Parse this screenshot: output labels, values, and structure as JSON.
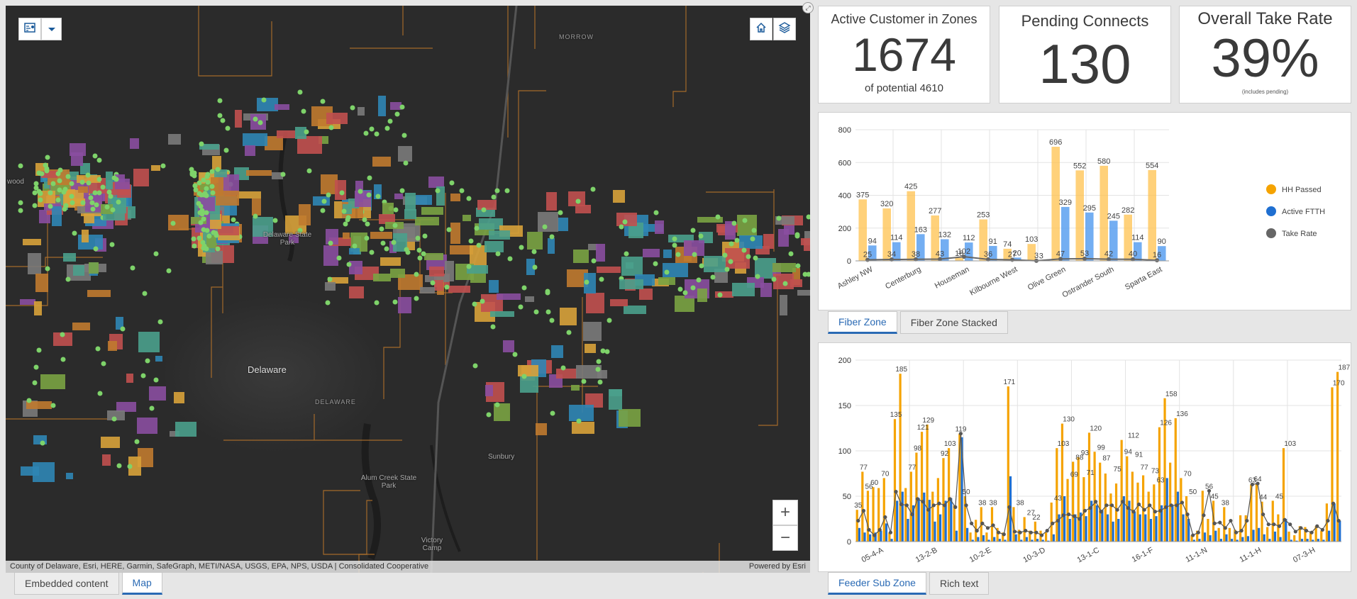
{
  "map": {
    "places": [
      {
        "text": "Delaware",
        "cls": "big"
      },
      {
        "text": "Delaware State Park",
        "cls": "small"
      },
      {
        "text": "MORROW",
        "cls": "tiny"
      },
      {
        "text": "DELAWARE",
        "cls": "tiny"
      },
      {
        "text": "Sunbury",
        "cls": "small"
      },
      {
        "text": "Alum Creek State Park",
        "cls": "small"
      },
      {
        "text": "Victory Camp",
        "cls": "small"
      },
      {
        "text": "wood",
        "cls": "small"
      }
    ],
    "attribution": "County of Delaware, Esri, HERE, Garmin, SafeGraph, METI/NASA, USGS, EPA, NPS, USDA | Consolidated Cooperative",
    "powered_by": "Powered by Esri",
    "zoom_in": "+",
    "zoom_out": "−",
    "icons": [
      "legend-icon",
      "chevron-down-icon",
      "home-icon",
      "layers-icon",
      "expand-icon"
    ]
  },
  "left_tabs": [
    {
      "label": "Embedded content",
      "active": false
    },
    {
      "label": "Map",
      "active": true
    }
  ],
  "kpis": [
    {
      "title": "Active Customer in Zones",
      "value": "1674",
      "subtitle": "of potential 4610"
    },
    {
      "title": "Pending Connects",
      "value": "130",
      "subtitle": ""
    },
    {
      "title": "Overall Take Rate",
      "value": "39%",
      "subtitle": "(includes pending)"
    }
  ],
  "chart_tabs_top": [
    {
      "label": "Fiber Zone",
      "active": true
    },
    {
      "label": "Fiber Zone Stacked",
      "active": false
    }
  ],
  "chart_tabs_bottom": [
    {
      "label": "Feeder Sub Zone",
      "active": true
    },
    {
      "label": "Rich text",
      "active": false
    }
  ],
  "colors": {
    "hh_passed": "#ffc24d",
    "hh_passed_bottom": "#f5a300",
    "active_ftth": "#5aa0f0",
    "active_ftth_bottom": "#1f6fd1",
    "take_rate": "#666666"
  },
  "chart_data": [
    {
      "type": "bar",
      "name": "fiber-zone",
      "categories": [
        "Ashley NW",
        "",
        "Centerburg",
        "",
        "Houseman",
        "",
        "Kilbourne West",
        "",
        "Olive Green",
        "",
        "Ostrander South",
        "",
        "Sparta East"
      ],
      "x_tick_labels": [
        "Ashley NW",
        "Centerburg",
        "Houseman",
        "Kilbourne West",
        "Olive Green",
        "Ostrander South",
        "Sparta East"
      ],
      "series": [
        {
          "name": "HH Passed",
          "values": [
            375,
            320,
            425,
            277,
            18,
            253,
            74,
            103,
            696,
            552,
            580,
            282,
            554
          ]
        },
        {
          "name": "Active FTTH",
          "values": [
            94,
            114,
            163,
            132,
            112,
            91,
            20,
            3,
            329,
            295,
            245,
            114,
            90
          ]
        },
        {
          "name": "Take Rate",
          "values": [
            25,
            34,
            38,
            43,
            102,
            36,
            27,
            3,
            47,
            53,
            42,
            40,
            16
          ]
        }
      ],
      "ylim": [
        0,
        800
      ],
      "yticks": [
        "0",
        "200",
        "400",
        "600",
        "800"
      ],
      "legend": "right",
      "grid": true
    },
    {
      "type": "bar",
      "name": "feeder-sub-zone",
      "x_tick_labels": [
        "05-4-A",
        "13-2-B",
        "10-2-E",
        "10-3-D",
        "13-1-C",
        "16-1-F",
        "11-1-N",
        "11-1-H",
        "07-3-H"
      ],
      "series": [
        {
          "name": "HH Passed",
          "values": [
            35,
            77,
            56,
            60,
            59,
            70,
            10,
            135,
            185,
            59,
            77,
            98,
            121,
            129,
            55,
            70,
            92,
            103,
            40,
            119,
            50,
            10,
            24,
            38,
            10,
            38,
            15,
            10,
            171,
            38,
            13,
            27,
            12,
            22,
            12,
            10,
            43,
            103,
            130,
            69,
            88,
            93,
            71,
            120,
            99,
            87,
            75,
            53,
            64,
            112,
            94,
            77,
            65,
            73,
            55,
            63,
            126,
            158,
            87,
            136,
            70,
            50,
            7,
            12,
            56,
            25,
            45,
            15,
            38,
            15,
            13,
            29,
            29,
            63,
            64,
            44,
            16,
            45,
            30,
            103,
            11,
            7,
            17,
            16,
            10,
            17,
            12,
            42,
            170,
            187
          ],
          "labeled": [
            [
              0,
              35
            ],
            [
              1,
              77
            ],
            [
              2,
              56
            ],
            [
              3,
              60
            ],
            [
              5,
              70
            ],
            [
              7,
              135
            ],
            [
              8,
              185
            ],
            [
              10,
              77
            ],
            [
              11,
              98
            ],
            [
              12,
              121
            ],
            [
              13,
              129
            ],
            [
              16,
              92
            ],
            [
              17,
              103
            ],
            [
              19,
              119
            ],
            [
              20,
              50
            ],
            [
              23,
              38
            ],
            [
              25,
              38
            ],
            [
              28,
              171
            ],
            [
              30,
              38
            ],
            [
              32,
              27
            ],
            [
              33,
              22
            ],
            [
              37,
              43
            ],
            [
              38,
              103
            ],
            [
              39,
              130
            ],
            [
              40,
              69
            ],
            [
              41,
              88
            ],
            [
              42,
              93
            ],
            [
              43,
              71
            ],
            [
              44,
              120
            ],
            [
              45,
              99
            ],
            [
              46,
              87
            ],
            [
              48,
              75
            ],
            [
              50,
              94
            ],
            [
              51,
              112
            ],
            [
              52,
              91
            ],
            [
              53,
              77
            ],
            [
              55,
              73
            ],
            [
              56,
              63
            ],
            [
              57,
              126
            ],
            [
              58,
              158
            ],
            [
              60,
              136
            ],
            [
              61,
              70
            ],
            [
              62,
              50
            ],
            [
              65,
              56
            ],
            [
              66,
              45
            ],
            [
              68,
              38
            ],
            [
              73,
              63
            ],
            [
              74,
              64
            ],
            [
              75,
              44
            ],
            [
              78,
              45
            ],
            [
              80,
              103
            ],
            [
              89,
              170
            ],
            [
              90,
              187
            ]
          ]
        },
        {
          "name": "Active FTTH",
          "values": [
            15,
            10,
            8,
            10,
            12,
            20,
            3,
            45,
            55,
            25,
            40,
            48,
            54,
            46,
            22,
            30,
            45,
            48,
            12,
            115,
            15,
            2,
            5,
            7,
            2,
            5,
            3,
            2,
            72,
            8,
            2,
            5,
            2,
            3,
            2,
            1,
            8,
            30,
            50,
            25,
            30,
            32,
            28,
            45,
            40,
            35,
            30,
            22,
            25,
            50,
            45,
            33,
            30,
            30,
            25,
            28,
            40,
            70,
            40,
            55,
            30,
            25,
            2,
            3,
            10,
            7,
            12,
            3,
            8,
            3,
            2,
            5,
            6,
            13,
            15,
            8,
            3,
            11,
            5,
            25,
            2,
            1,
            3,
            3,
            2,
            3,
            2,
            12,
            42,
            23
          ]
        },
        {
          "name": "Take Rate",
          "values": [
            23,
            34,
            13,
            7,
            13,
            27,
            10,
            55,
            41,
            40,
            30,
            47,
            44,
            35,
            40,
            42,
            40,
            47,
            38,
            119,
            40,
            20,
            12,
            20,
            15,
            18,
            10,
            8,
            38,
            11,
            10,
            12,
            10,
            10,
            7,
            12,
            20,
            23,
            29,
            30,
            28,
            25,
            34,
            37,
            44,
            33,
            40,
            40,
            35,
            44,
            37,
            33,
            41,
            35,
            40,
            33,
            34,
            38,
            40,
            40,
            43,
            30,
            7,
            10,
            29,
            56,
            20,
            21,
            15,
            23,
            10,
            12,
            23,
            63,
            64,
            30,
            19,
            19,
            17,
            24,
            19,
            11,
            15,
            12,
            10,
            17,
            13,
            23,
            42,
            23
          ]
        }
      ],
      "ylim": [
        0,
        200
      ],
      "yticks": [
        "0",
        "50",
        "100",
        "150",
        "200"
      ],
      "grid": true
    }
  ]
}
